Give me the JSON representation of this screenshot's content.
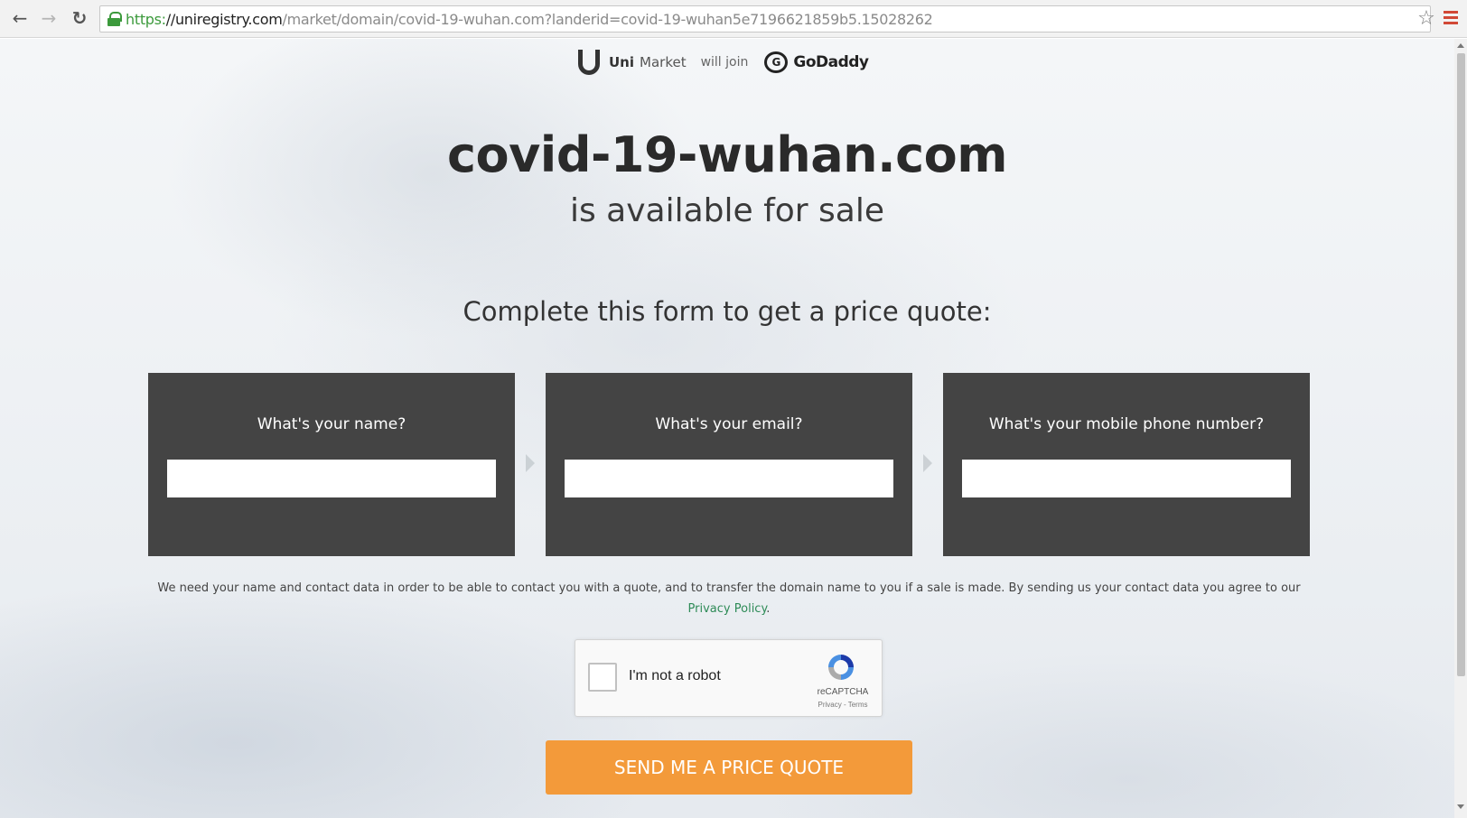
{
  "browser": {
    "url_scheme": "https:",
    "url_host": "//uniregistry.com",
    "url_path": "/market/domain/covid-19-wuhan.com?landerid=covid-19-wuhan5e7196621859b5.15028262"
  },
  "brand": {
    "uni": "Uni",
    "market": "Market",
    "will_join": "will join",
    "godaddy": "GoDaddy"
  },
  "headline": {
    "domain": "covid-19-wuhan.com",
    "subtitle": "is available for sale"
  },
  "form": {
    "prompt": "Complete this form to get a price quote:",
    "name_label": "What's your name?",
    "email_label": "What's your email?",
    "phone_label": "What's your mobile phone number?",
    "name_value": "",
    "email_value": "",
    "phone_value": ""
  },
  "disclaimer": {
    "text": "We need your name and contact data in order to be able to contact you with a quote, and to transfer the domain name to you if a sale is made. By sending us your contact data you agree to our ",
    "link": "Privacy Policy",
    "end": "."
  },
  "recaptcha": {
    "label": "I'm not a robot",
    "brand": "reCAPTCHA",
    "terms": "Privacy - Terms"
  },
  "cta": {
    "label": "SEND ME A PRICE QUOTE"
  },
  "colors": {
    "panel": "#444444",
    "cta": "#f39a3a",
    "link": "#2e8b57"
  }
}
